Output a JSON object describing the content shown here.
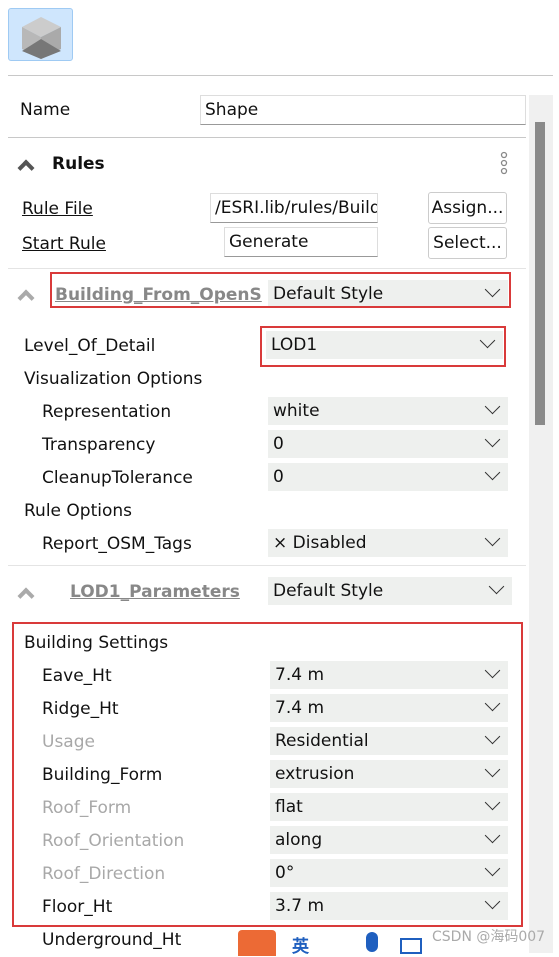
{
  "header": {
    "icon": "cube-icon"
  },
  "name": {
    "label": "Name",
    "value": "Shape"
  },
  "rules": {
    "title": "Rules",
    "rule_file_label": "Rule File",
    "rule_file_value": "/ESRI.lib/rules/Build",
    "assign_button": "Assign...",
    "start_rule_label": "Start Rule",
    "start_rule_value": "Generate",
    "select_button": "Select..."
  },
  "building": {
    "title": "Building_From_OpenS",
    "style": "Default Style"
  },
  "attrs": [
    {
      "label": "Level_Of_Detail",
      "value": "LOD1"
    },
    {
      "label": "Visualization Options"
    },
    {
      "label": "Representation",
      "value": "white"
    },
    {
      "label": "Transparency",
      "value": "0"
    },
    {
      "label": "CleanupTolerance",
      "value": "0"
    },
    {
      "label": "Rule Options"
    },
    {
      "label": "Report_OSM_Tags",
      "value": "× Disabled"
    }
  ],
  "lod1": {
    "title": "LOD1_Parameters",
    "style": "Default Style"
  },
  "settings": {
    "title": "Building Settings",
    "rows": [
      {
        "label": "Eave_Ht",
        "value": "7.4 m",
        "disabled": false
      },
      {
        "label": "Ridge_Ht",
        "value": "7.4 m",
        "disabled": false
      },
      {
        "label": "Usage",
        "value": "Residential",
        "disabled": true
      },
      {
        "label": "Building_Form",
        "value": "extrusion",
        "disabled": false
      },
      {
        "label": "Roof_Form",
        "value": "flat",
        "disabled": true
      },
      {
        "label": "Roof_Orientation",
        "value": "along",
        "disabled": true
      },
      {
        "label": "Roof_Direction",
        "value": "0°",
        "disabled": true
      },
      {
        "label": "Floor_Ht",
        "value": "3.7 m",
        "disabled": false
      },
      {
        "label": "Underground_Ht"
      }
    ]
  },
  "watermark": "CSDN @海码007",
  "ime": {
    "lang": "英"
  },
  "colors": {
    "highlight": "#d93a3a",
    "dropdown_bg": "#eef0ee"
  }
}
